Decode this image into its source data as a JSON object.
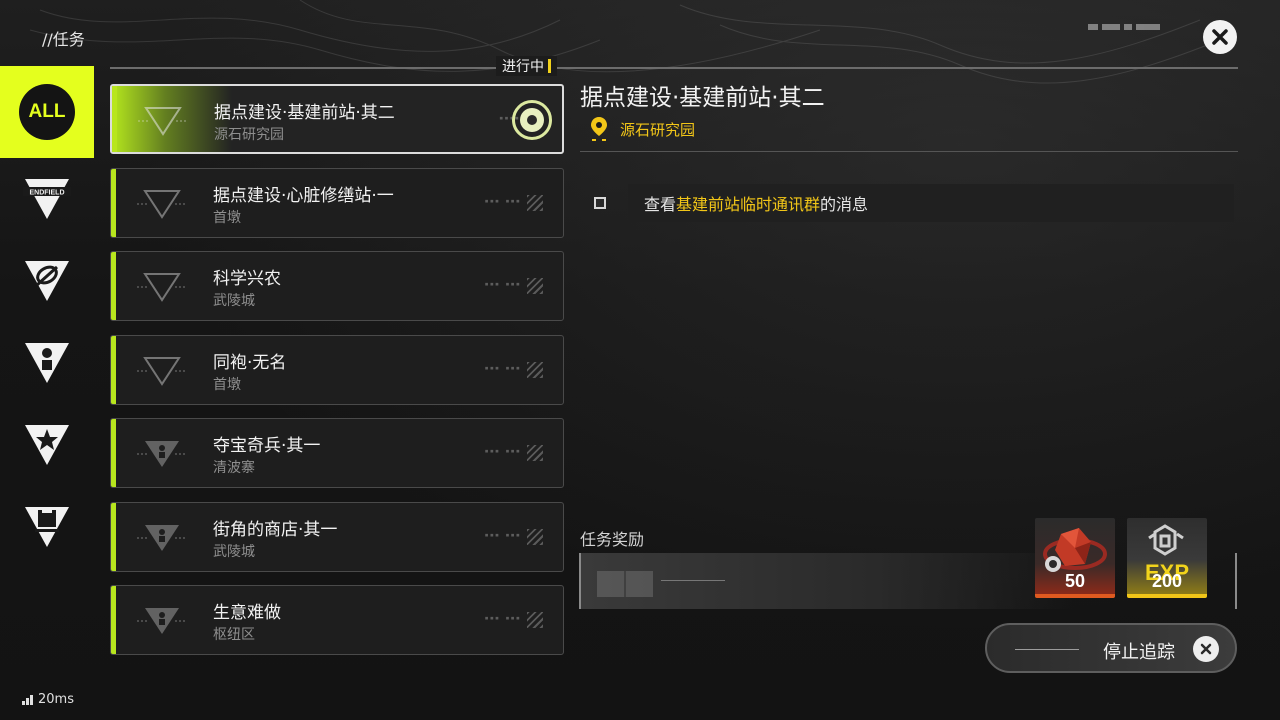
{
  "header": {
    "page_title": "//任务",
    "status_label": "进行中"
  },
  "sidebar": {
    "items": [
      {
        "label": "ALL",
        "icon": "all-icon",
        "active": true
      },
      {
        "label": "ENDFIELD",
        "icon": "endfield-icon"
      },
      {
        "icon": "pen-nib-icon"
      },
      {
        "icon": "person-icon"
      },
      {
        "icon": "star-icon"
      },
      {
        "icon": "building-icon"
      }
    ]
  },
  "quests": [
    {
      "name": "据点建设·基建前站·其二",
      "location": "源石研究园",
      "active": true
    },
    {
      "name": "据点建设·心脏修缮站·一",
      "location": "首墩"
    },
    {
      "name": "科学兴农",
      "location": "武陵城"
    },
    {
      "name": "同袍·无名",
      "location": "首墩"
    },
    {
      "name": "夺宝奇兵·其一",
      "location": "清波寨"
    },
    {
      "name": "街角的商店·其一",
      "location": "武陵城"
    },
    {
      "name": "生意难做",
      "location": "枢纽区"
    }
  ],
  "detail": {
    "title": "据点建设·基建前站·其二",
    "location": "源石研究园",
    "objective_prefix": "查看",
    "objective_highlight": "基建前站临时通讯群",
    "objective_suffix": "的消息"
  },
  "rewards": {
    "label": "任务奖励",
    "items": [
      {
        "icon": "originium-crystal-icon",
        "quantity": "50"
      },
      {
        "icon": "exp-icon",
        "title": "EXP",
        "quantity": "200"
      }
    ]
  },
  "actions": {
    "stop_tracking_label": "停止追踪"
  },
  "status": {
    "ping": "20ms"
  },
  "colors": {
    "accent_green": "#b8e61e",
    "highlight_yellow": "#f2c618",
    "sidebar_active": "#e4ff1e"
  }
}
